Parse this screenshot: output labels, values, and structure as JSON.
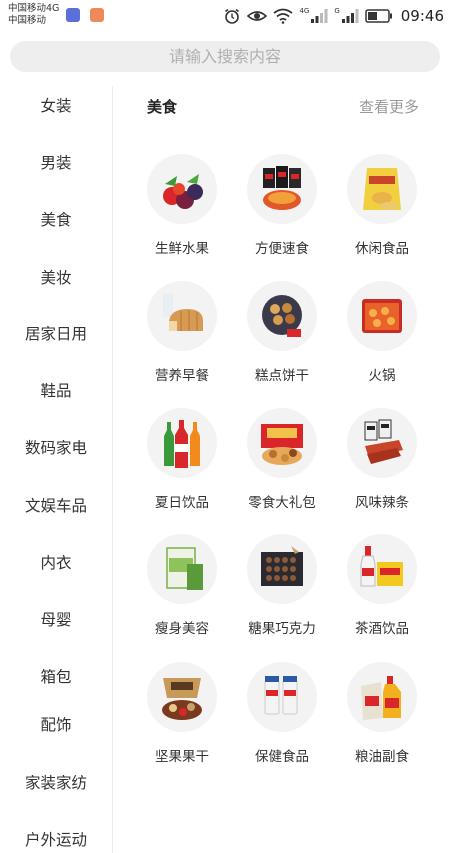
{
  "status_bar": {
    "carrier_line1": "中国移动4G",
    "carrier_line2": "中国移动",
    "net_4g": "4G",
    "net_g": "G",
    "time": "09:46"
  },
  "search": {
    "placeholder": "请输入搜索内容"
  },
  "sidebar": {
    "items": [
      {
        "label": "女装"
      },
      {
        "label": "男装"
      },
      {
        "label": "美食"
      },
      {
        "label": "美妆"
      },
      {
        "label": "居家日用"
      },
      {
        "label": "鞋品"
      },
      {
        "label": "数码家电"
      },
      {
        "label": "文娱车品"
      },
      {
        "label": "内衣"
      },
      {
        "label": "母婴"
      },
      {
        "label": "箱包"
      },
      {
        "label": "配饰"
      },
      {
        "label": "家装家纺"
      },
      {
        "label": "户外运动"
      }
    ]
  },
  "section": {
    "title": "美食",
    "more": "查看更多"
  },
  "categories": [
    {
      "label": "生鲜水果",
      "icon": "fruit-icon"
    },
    {
      "label": "方便速食",
      "icon": "instant-food-icon"
    },
    {
      "label": "休闲食品",
      "icon": "snack-bag-icon"
    },
    {
      "label": "营养早餐",
      "icon": "bread-milk-icon"
    },
    {
      "label": "糕点饼干",
      "icon": "cookies-icon"
    },
    {
      "label": "火锅",
      "icon": "hotpot-icon"
    },
    {
      "label": "夏日饮品",
      "icon": "soda-bottles-icon"
    },
    {
      "label": "零食大礼包",
      "icon": "gift-pack-icon"
    },
    {
      "label": "风味辣条",
      "icon": "spicy-strips-icon"
    },
    {
      "label": "瘦身美容",
      "icon": "slimming-box-icon"
    },
    {
      "label": "糖果巧克力",
      "icon": "chocolate-box-icon"
    },
    {
      "label": "茶酒饮品",
      "icon": "tea-liquor-icon"
    },
    {
      "label": "坚果果干",
      "icon": "nuts-icon"
    },
    {
      "label": "保健食品",
      "icon": "supplement-bottles-icon"
    },
    {
      "label": "粮油副食",
      "icon": "rice-oil-icon"
    }
  ]
}
